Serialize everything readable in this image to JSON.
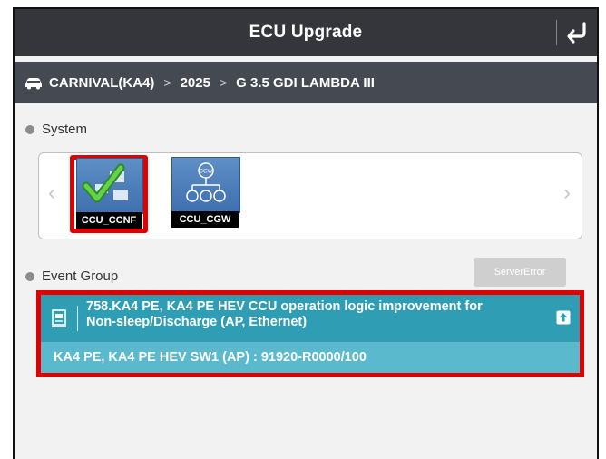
{
  "header": {
    "title": "ECU Upgrade"
  },
  "breadcrumb": {
    "vehicle": "CARNIVAL(KA4)",
    "year": "2025",
    "engine": "G 3.5 GDI LAMBDA III",
    "separator": ">"
  },
  "system": {
    "label": "System",
    "items": [
      {
        "label": "CCU_CCNF",
        "selected": true
      },
      {
        "label": "CCU_CGW",
        "selected": false,
        "badge": "CGW"
      }
    ]
  },
  "event_group": {
    "label": "Event Group",
    "server_button": "ServerError",
    "event": {
      "title_line1": "758.KA4 PE, KA4 PE HEV CCU operation logic improvement for",
      "title_line2": "Non-sleep/Discharge (AP, Ethernet)",
      "detail": "KA4 PE, KA4 PE HEV SW1 (AP) : 91920-R0000/100"
    }
  },
  "colors": {
    "header": "#34363b",
    "breadcrumb": "#454a52",
    "event": "#2f9db4",
    "highlight": "#e00000"
  }
}
